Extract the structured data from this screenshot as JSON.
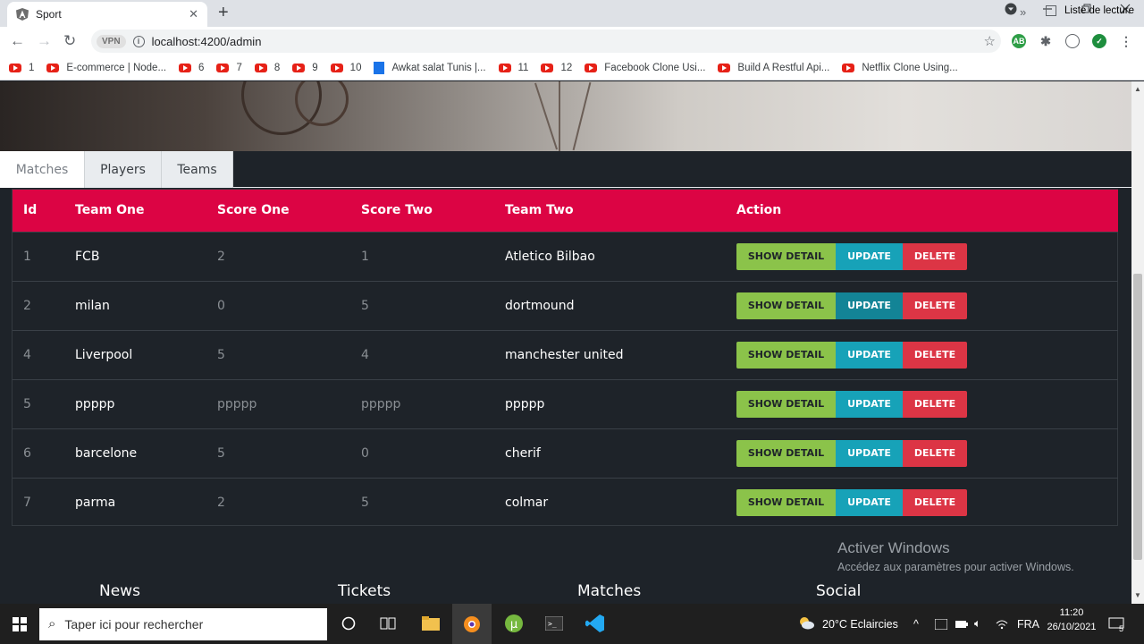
{
  "browser": {
    "tab_title": "Sport",
    "tab_close": "✕",
    "new_tab": "+",
    "url": "localhost:4200/admin",
    "vpn_label": "VPN",
    "bookmarks": [
      {
        "label": "1",
        "type": "yt"
      },
      {
        "label": "E-commerce | Node...",
        "type": "yt"
      },
      {
        "label": "6",
        "type": "yt"
      },
      {
        "label": "7",
        "type": "yt"
      },
      {
        "label": "8",
        "type": "yt"
      },
      {
        "label": "9",
        "type": "yt"
      },
      {
        "label": "10",
        "type": "yt"
      },
      {
        "label": "Awkat salat Tunis |...",
        "type": "doc"
      },
      {
        "label": "11",
        "type": "yt"
      },
      {
        "label": "12",
        "type": "yt"
      },
      {
        "label": "Facebook Clone Usi...",
        "type": "yt"
      },
      {
        "label": "Build A Restful Api...",
        "type": "yt"
      },
      {
        "label": "Netflix Clone Using...",
        "type": "yt"
      }
    ],
    "more_bookmarks": "»",
    "reading_list": "Liste de lecture",
    "ext_ab": "AB"
  },
  "tabs": [
    "Matches",
    "Players",
    "Teams"
  ],
  "table": {
    "headers": [
      "Id",
      "Team One",
      "Score One",
      "Score Two",
      "Team Two",
      "Action"
    ],
    "rows": [
      [
        "1",
        "FCB",
        "2",
        "1",
        "Atletico Bilbao"
      ],
      [
        "2",
        "milan",
        "0",
        "5",
        "dortmound"
      ],
      [
        "4",
        "Liverpool",
        "5",
        "4",
        "manchester united"
      ],
      [
        "5",
        "ppppp",
        "ppppp",
        "ppppp",
        "ppppp"
      ],
      [
        "6",
        "barcelone",
        "5",
        "0",
        "cherif"
      ],
      [
        "7",
        "parma",
        "2",
        "5",
        "colmar"
      ]
    ],
    "actions": {
      "show": "SHOW DETAIL",
      "update": "UPDATE",
      "delete": "DELETE"
    }
  },
  "footer": {
    "links": [
      "News",
      "Tickets",
      "Matches",
      "Social"
    ]
  },
  "activate_windows": {
    "title": "Activer Windows",
    "subtitle": "Accédez aux paramètres pour activer Windows."
  },
  "taskbar": {
    "search_placeholder": "Taper ici pour rechercher",
    "weather": "20°C  Eclaircies",
    "language": "FRA",
    "time": "11:20",
    "date": "26/10/2021",
    "notifications": "5"
  }
}
